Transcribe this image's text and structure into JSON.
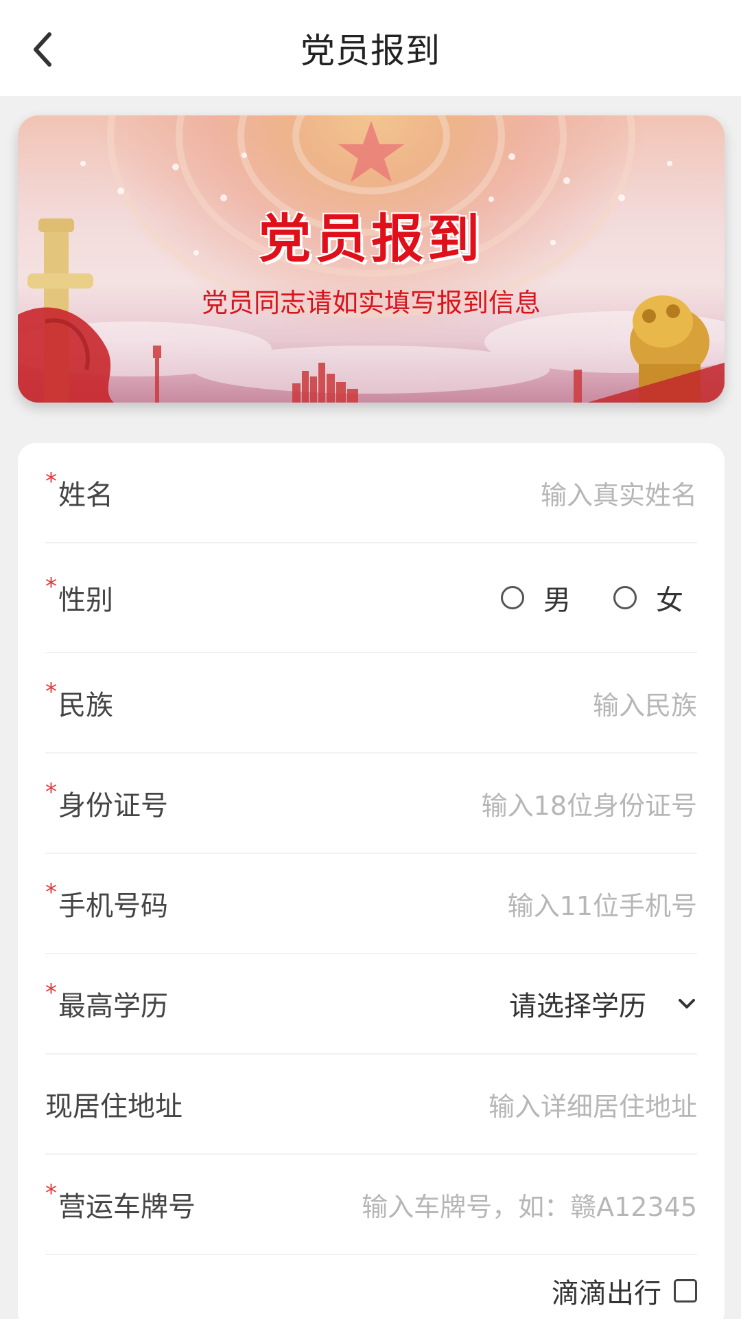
{
  "header": {
    "title": "党员报到"
  },
  "banner": {
    "title": "党员报到",
    "subtitle": "党员同志请如实填写报到信息"
  },
  "colors": {
    "accent_red": "#e0101a",
    "required_star": "#e23b3b",
    "placeholder": "#b6b6b6"
  },
  "form": {
    "name": {
      "required": "*",
      "label": "姓名",
      "placeholder": "输入真实姓名"
    },
    "gender": {
      "required": "*",
      "label": "性别",
      "options": [
        "男",
        "女"
      ]
    },
    "ethnicity": {
      "required": "*",
      "label": "民族",
      "placeholder": "输入民族"
    },
    "id_number": {
      "required": "*",
      "label": "身份证号",
      "placeholder": "输入18位身份证号"
    },
    "phone": {
      "required": "*",
      "label": "手机号码",
      "placeholder": "输入11位手机号"
    },
    "education": {
      "required": "*",
      "label": "最高学历",
      "value": "请选择学历"
    },
    "address": {
      "label": "现居住地址",
      "placeholder": "输入详细居住地址"
    },
    "plate": {
      "required": "*",
      "label": "营运车牌号",
      "placeholder": "输入车牌号，如：赣A12345"
    },
    "platform": {
      "label": "滴滴出行"
    }
  },
  "icons": {
    "back": "chevron-left-icon",
    "dropdown": "chevron-down-icon",
    "checkbox": "checkbox-icon"
  }
}
